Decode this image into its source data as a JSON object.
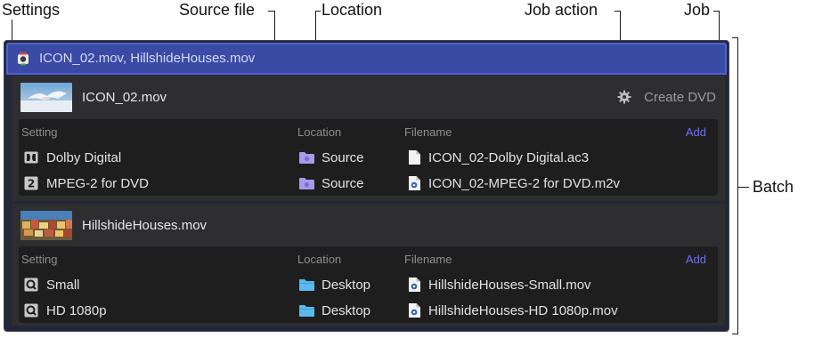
{
  "callouts": {
    "settings": "Settings",
    "source_file": "Source file",
    "location": "Location",
    "job_action": "Job action",
    "job": "Job",
    "batch": "Batch"
  },
  "batch": {
    "title": "ICON_02.mov, HillshideHouses.mov",
    "jobs": [
      {
        "source": "ICON_02.mov",
        "action": "Create DVD",
        "thumbnail_icon": "seagull-thumbnail",
        "headers": {
          "setting": "Setting",
          "location": "Location",
          "filename": "Filename",
          "add": "Add"
        },
        "rows": [
          {
            "setting_icon": "dolby-icon",
            "setting": "Dolby Digital",
            "location_icon": "purple-folder-icon",
            "location": "Source",
            "file_icon": "document-icon",
            "filename": "ICON_02-Dolby Digital.ac3"
          },
          {
            "setting_icon": "number-2-icon",
            "setting": "MPEG-2 for DVD",
            "location_icon": "purple-folder-icon",
            "location": "Source",
            "file_icon": "video-file-icon",
            "filename": "ICON_02-MPEG-2 for DVD.m2v"
          }
        ]
      },
      {
        "source": "HillshideHouses.mov",
        "thumbnail_icon": "houses-thumbnail",
        "headers": {
          "setting": "Setting",
          "location": "Location",
          "filename": "Filename",
          "add": "Add"
        },
        "rows": [
          {
            "setting_icon": "quicktime-icon",
            "setting": "Small",
            "location_icon": "blue-folder-icon",
            "location": "Desktop",
            "file_icon": "video-file-icon",
            "filename": "HillshideHouses-Small.mov"
          },
          {
            "setting_icon": "quicktime-icon",
            "setting": "HD 1080p",
            "location_icon": "blue-folder-icon",
            "location": "Desktop",
            "file_icon": "video-file-icon",
            "filename": "HillshideHouses-HD 1080p.mov"
          }
        ]
      }
    ]
  },
  "colors": {
    "header_accent": "#3a4aa5",
    "add_link": "#6f6ff0",
    "purple_folder": "#a99ae8",
    "blue_folder": "#5ab9f0"
  }
}
